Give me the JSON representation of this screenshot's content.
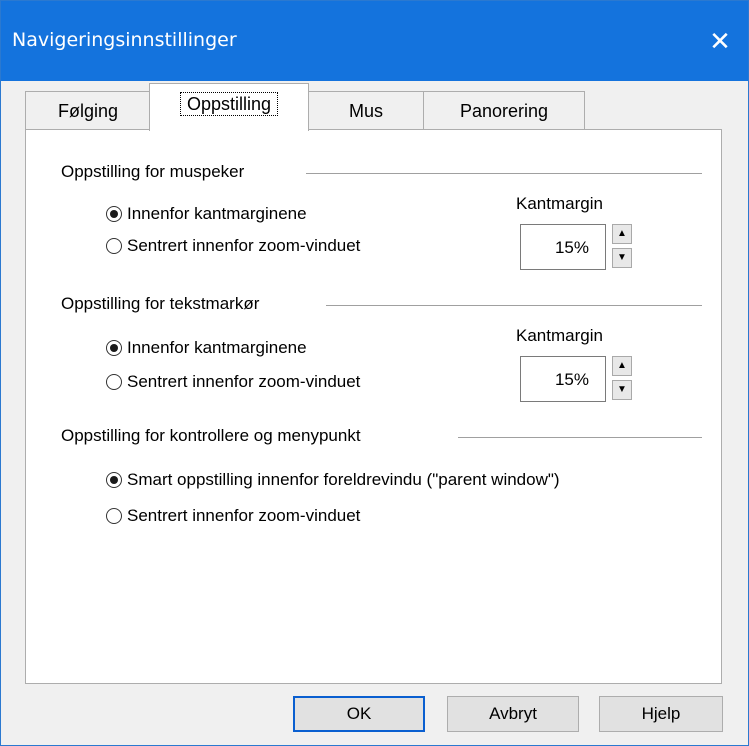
{
  "window": {
    "title": "Navigeringsinnstillinger"
  },
  "tabs": [
    {
      "label": "Følging"
    },
    {
      "label": "Oppstilling"
    },
    {
      "label": "Mus"
    },
    {
      "label": "Panorering"
    }
  ],
  "groups": {
    "mouse": {
      "title": "Oppstilling for muspeker",
      "option1": "Innenfor kantmarginene",
      "option2": "Sentrert innenfor zoom-vinduet",
      "selected": "option1",
      "margin_label": "Kantmargin",
      "margin_value": "15%"
    },
    "text": {
      "title": "Oppstilling for tekstmarkør",
      "option1": "Innenfor kantmarginene",
      "option2": "Sentrert innenfor zoom-vinduet",
      "selected": "option1",
      "margin_label": "Kantmargin",
      "margin_value": "15%"
    },
    "controls": {
      "title": "Oppstilling for kontrollere og menypunkt",
      "option1": "Smart oppstilling innenfor foreldrevindu (\"parent window\")",
      "option2": "Sentrert innenfor zoom-vinduet",
      "selected": "option1"
    }
  },
  "buttons": {
    "ok": "OK",
    "cancel": "Avbryt",
    "help": "Hjelp"
  },
  "icons": {
    "close": "close-icon",
    "spin_up": "up-arrow-icon",
    "spin_down": "down-arrow-icon"
  }
}
